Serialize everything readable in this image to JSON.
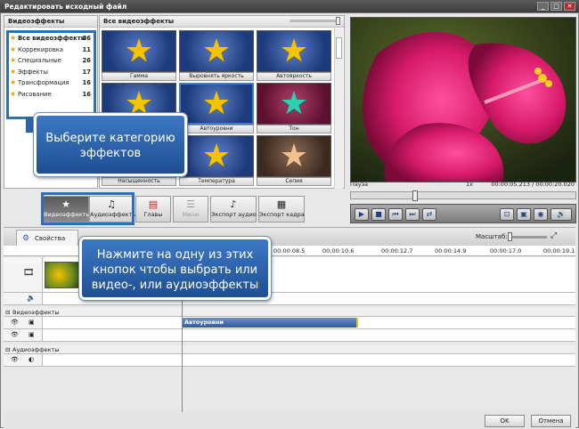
{
  "window": {
    "title": "Редактировать исходный файл",
    "minimize": "_",
    "maximize": "□",
    "close": "✕"
  },
  "categories": {
    "header": "Видеоэффекты",
    "items": [
      {
        "label": "Все видеоэффекты",
        "count": "86"
      },
      {
        "label": "Коррекировка",
        "count": "11"
      },
      {
        "label": "Специальные",
        "count": "26"
      },
      {
        "label": "Эффекты",
        "count": "17"
      },
      {
        "label": "Трансформация",
        "count": "16"
      },
      {
        "label": "Рисование",
        "count": "16"
      }
    ]
  },
  "effects": {
    "header": "Все видеоэффекты",
    "tiles": [
      {
        "label": "Гамма",
        "star": "gold-star-icon"
      },
      {
        "label": "Выровнять яркость",
        "star": "gold-star-icon"
      },
      {
        "label": "Автояркость",
        "star": "gold-star-icon"
      },
      {
        "label": "",
        "star": "gold-star-icon"
      },
      {
        "label": "Автоуровни",
        "star": "gold-star-icon"
      },
      {
        "label": "Тон",
        "star": "teal-star-icon"
      },
      {
        "label": "Насыщенность",
        "star": "gold-star-icon"
      },
      {
        "label": "Температура",
        "star": "gold-star-icon"
      },
      {
        "label": "Сепия",
        "star": "tan-star-icon"
      }
    ]
  },
  "callouts": {
    "category": "Выберите категорию эффектов",
    "buttons": "Нажмите на одну из этих кнопок чтобы выбрать или видео-, или аудиоэффекты"
  },
  "player": {
    "status": "Пауза",
    "speed": "1x",
    "time": "00:00:05.213 / 00:00:20.020",
    "position": 0.28
  },
  "toolbar": {
    "video_effects": "Видеоэффекты",
    "audio_effects": "Аудиоэффекты",
    "chapters": "Главы",
    "menu": "Меню",
    "export_audio": "Экспорт аудио",
    "export_frame": "Экспорт кадра"
  },
  "tabs": {
    "properties": "Свойства",
    "scale_label": "Масштаб:"
  },
  "ruler": {
    "marks": [
      "00:00:08.5",
      "00:00:10.6",
      "00:00:12.7",
      "00:00:14.9",
      "00:00:17.0",
      "00:00:19.1"
    ]
  },
  "timeline": {
    "video_section": "Видеоэффекты",
    "audio_section": "Аудиоэффекты",
    "clip_label": "Автоуровни"
  },
  "footer": {
    "ok": "OK",
    "cancel": "Отмена"
  },
  "colors": {
    "accent": "#2f6fb5",
    "callout": "#2a62ad",
    "star": "#f5c400"
  }
}
